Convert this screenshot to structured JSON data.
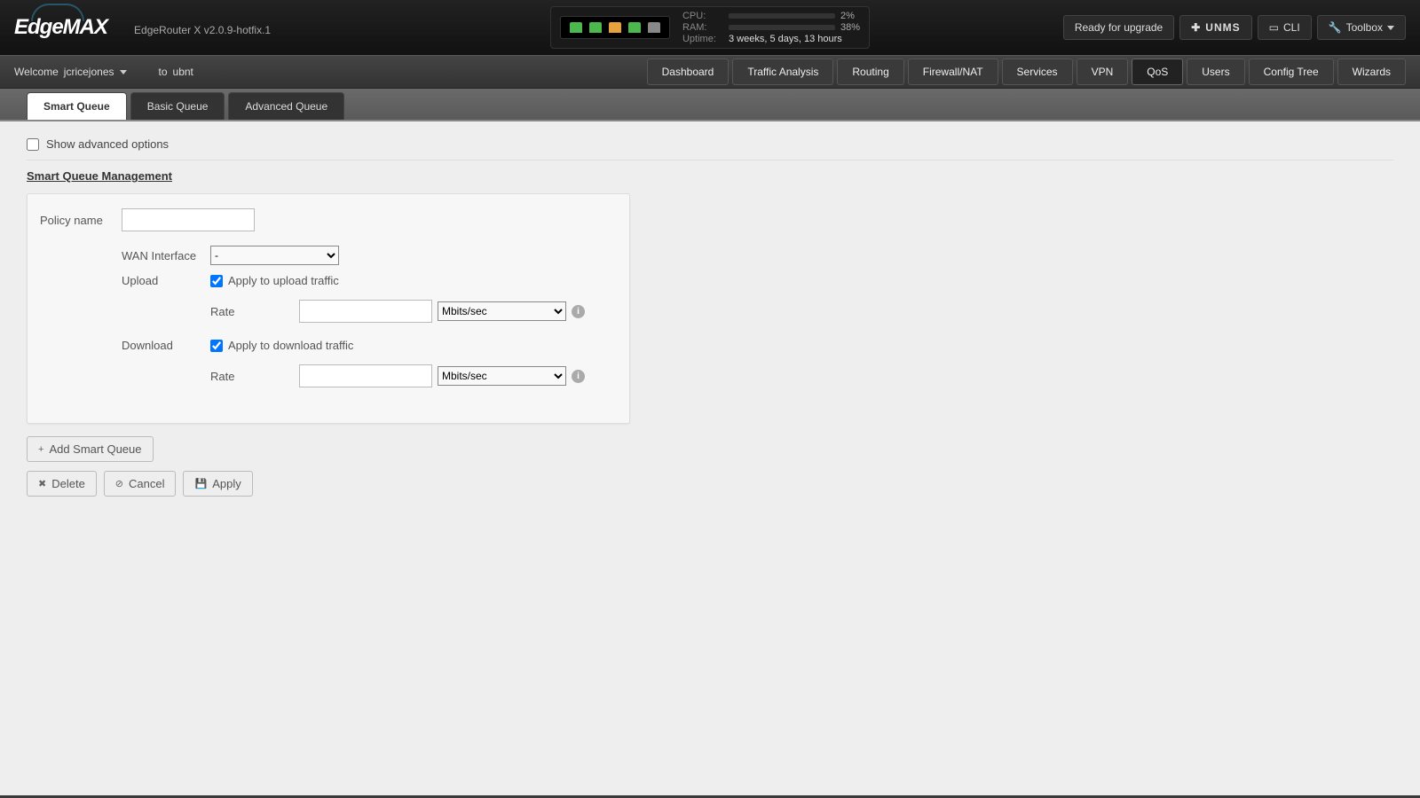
{
  "brand": {
    "logo": "EdgeMAX",
    "device": "EdgeRouter X v2.0.9-hotfix.1"
  },
  "status": {
    "cpu_label": "CPU:",
    "cpu_pct": 2,
    "cpu_text": "2%",
    "ram_label": "RAM:",
    "ram_pct": 38,
    "ram_text": "38%",
    "uptime_label": "Uptime:",
    "uptime_text": "3 weeks, 5 days, 13 hours"
  },
  "topbar": {
    "upgrade": "Ready for upgrade",
    "unms": "UNMS",
    "cli": "CLI",
    "toolbox": "Toolbox"
  },
  "subbar": {
    "welcome_prefix": "Welcome",
    "username": "jcricejones",
    "to": "to",
    "host": "ubnt"
  },
  "nav": [
    "Dashboard",
    "Traffic Analysis",
    "Routing",
    "Firewall/NAT",
    "Services",
    "VPN",
    "QoS",
    "Users",
    "Config Tree",
    "Wizards"
  ],
  "nav_active": "QoS",
  "tabs": [
    "Smart Queue",
    "Basic Queue",
    "Advanced Queue"
  ],
  "tabs_active": "Smart Queue",
  "adv_label": "Show advanced options",
  "section_title": "Smart Queue Management",
  "form": {
    "policy_label": "Policy name",
    "policy_value": "",
    "wan_label": "WAN Interface",
    "wan_value": "-",
    "upload_label": "Upload",
    "upload_apply_label": "Apply to upload traffic",
    "download_label": "Download",
    "download_apply_label": "Apply to download traffic",
    "rate_label": "Rate",
    "rate_upload_value": "",
    "rate_download_value": "",
    "unit_value": "Mbits/sec"
  },
  "buttons": {
    "add": "Add Smart Queue",
    "delete": "Delete",
    "cancel": "Cancel",
    "apply": "Apply"
  }
}
